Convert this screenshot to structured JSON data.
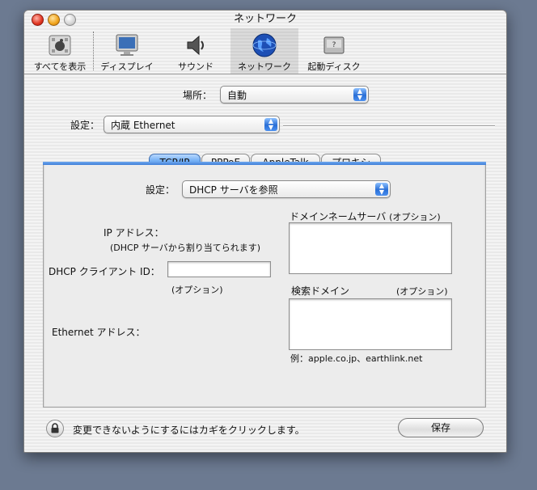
{
  "window": {
    "title": "ネットワーク"
  },
  "toolbar": {
    "items": [
      {
        "label": "すべてを表示",
        "icon": "apple-prefs-icon"
      },
      {
        "label": "ディスプレイ",
        "icon": "display-icon"
      },
      {
        "label": "サウンド",
        "icon": "speaker-icon"
      },
      {
        "label": "ネットワーク",
        "icon": "globe-icon",
        "selected": true
      },
      {
        "label": "起動ディスク",
        "icon": "disk-icon"
      }
    ]
  },
  "location": {
    "label": "場所：",
    "value": "自動"
  },
  "config": {
    "label": "設定：",
    "value": "内蔵 Ethernet"
  },
  "tabs": [
    {
      "label": "TCP/IP",
      "active": true
    },
    {
      "label": "PPPoE"
    },
    {
      "label": "AppleTalk"
    },
    {
      "label": "プロキシ"
    }
  ],
  "tcpip": {
    "configure_label": "設定：",
    "configure_value": "DHCP サーバを参照",
    "ip_label": "IP アドレス：",
    "ip_note": "(DHCP サーバから割り当てられます)",
    "client_id_label": "DHCP クライアント ID：",
    "client_id_value": "",
    "client_id_note": "(オプション)",
    "ethernet_label": "Ethernet アドレス：",
    "dns_label": "ドメインネームサーバ",
    "dns_optional": "(オプション)",
    "dns_value": "",
    "search_label": "検索ドメイン",
    "search_optional": "(オプション)",
    "search_value": "",
    "example": "例：apple.co.jp、earthlink.net"
  },
  "footer": {
    "lock_text": "変更できないようにするにはカギをクリックします。",
    "save_label": "保存"
  },
  "colors": {
    "accent": "#2a6fd6",
    "desktop": "#6c7a91"
  }
}
